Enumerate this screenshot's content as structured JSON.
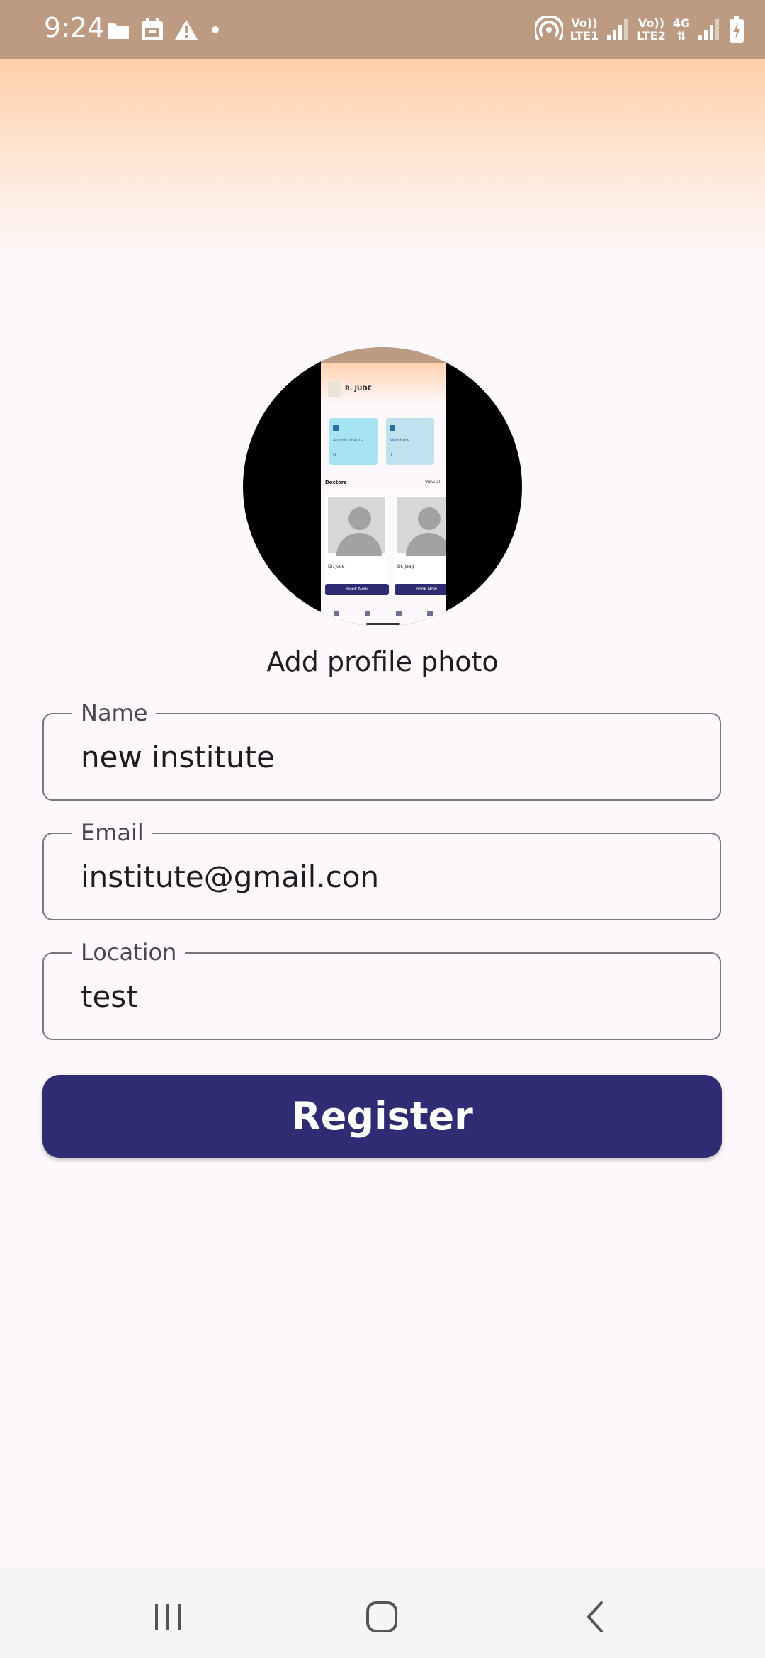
{
  "status_bar": {
    "time": "9:24",
    "left_icons": [
      "folder-icon",
      "calendar-icon",
      "warning-icon",
      "dot-icon"
    ],
    "sim1_label_top": "Vo))",
    "sim1_label_bottom": "LTE1",
    "sim2_label_top": "Vo))",
    "sim2_label_bottom": "LTE2",
    "network_type": "4G",
    "right_icons": [
      "hotspot-icon",
      "signal-icon",
      "signal-icon",
      "battery-charging-icon"
    ]
  },
  "profile": {
    "add_photo_label": "Add profile photo",
    "preview": {
      "name": "R. JUDE",
      "card1_label": "Appointments",
      "card1_value": "0",
      "card2_label": "Members",
      "card2_value": "1",
      "section_title": "Doctors",
      "view_all": "View all",
      "doctor1": "Dr. Jude",
      "doctor2": "Dr. Jaag",
      "book_label": "Book Now"
    }
  },
  "form": {
    "name_label": "Name",
    "name_value": "new institute",
    "email_label": "Email",
    "email_value": "institute@gmail.con",
    "location_label": "Location",
    "location_value": "test",
    "register_label": "Register"
  },
  "nav": {
    "recents": "recents-icon",
    "home": "home-icon",
    "back": "back-icon"
  },
  "colors": {
    "status_bar": "#bd9a82",
    "primary": "#2f2c73",
    "background": "#fdf8fb"
  }
}
